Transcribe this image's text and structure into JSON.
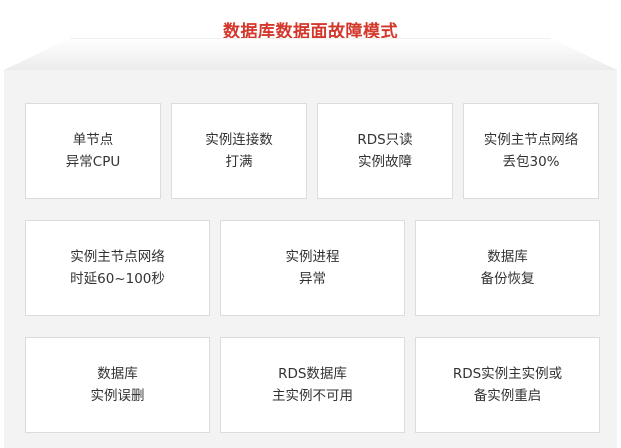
{
  "title": "数据库数据面故障模式",
  "rows": [
    [
      {
        "line1": "单节点",
        "line2": "异常CPU"
      },
      {
        "line1": "实例连接数",
        "line2": "打满"
      },
      {
        "line1": "RDS只读",
        "line2": "实例故障"
      },
      {
        "line1": "实例主节点网络",
        "line2": "丢包30%"
      }
    ],
    [
      {
        "line1": "实例主节点网络",
        "line2": "时延60~100秒"
      },
      {
        "line1": "实例进程",
        "line2": "异常"
      },
      {
        "line1": "数据库",
        "line2": "备份恢复"
      }
    ],
    [
      {
        "line1": "数据库",
        "line2": "实例误删"
      },
      {
        "line1": "RDS数据库",
        "line2": "主实例不可用"
      },
      {
        "line1": "RDS实例主实例或",
        "line2": "备实例重启"
      }
    ]
  ],
  "colors": {
    "title": "#d4382c",
    "panel": "#f3f3f3",
    "card_border": "#dcdcdc",
    "text": "#333333"
  }
}
